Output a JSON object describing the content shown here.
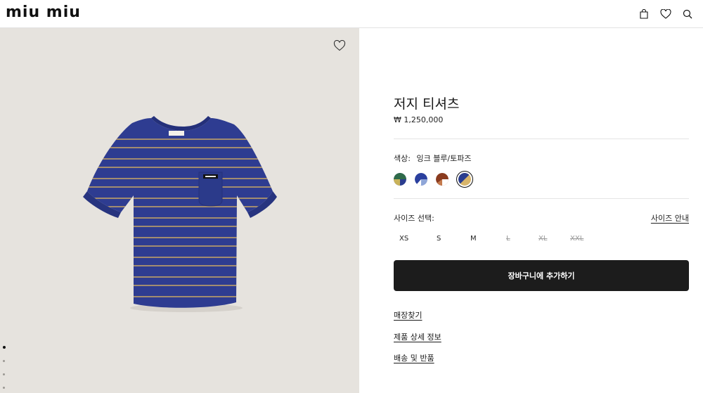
{
  "header": {
    "logo": "miu miu",
    "icons": [
      "bag-icon",
      "heart-icon",
      "search-icon"
    ]
  },
  "image": {
    "alt": "Striped jersey T-shirt",
    "pocket_label": "MIU MIU",
    "neck_label": "Miu Miu",
    "slides": 4,
    "active_slide": 1
  },
  "product": {
    "title": "저지 티셔츠",
    "price": "₩ 1,250,000",
    "color_label": "색상:",
    "color_value": "잉크 블루/토파즈",
    "swatches": [
      {
        "name": "swatch-green-blue",
        "colors": [
          "#2f6b4a",
          "#c9b35a",
          "#2a3d8f"
        ]
      },
      {
        "name": "swatch-blue-white",
        "colors": [
          "#2a3f9e",
          "#ffffff",
          "#8fa6d8"
        ]
      },
      {
        "name": "swatch-brown-white",
        "colors": [
          "#8a3b1f",
          "#ffffff",
          "#c47a4d"
        ]
      },
      {
        "name": "swatch-ink-blue-topaz",
        "colors": [
          "#2a3d8f",
          "#d8b56a"
        ],
        "selected": true
      }
    ],
    "size_label": "사이즈 선택:",
    "size_guide": "사이즈 안내",
    "sizes": [
      {
        "label": "XS",
        "available": true
      },
      {
        "label": "S",
        "available": true
      },
      {
        "label": "M",
        "available": true
      },
      {
        "label": "L",
        "available": false
      },
      {
        "label": "XL",
        "available": false
      },
      {
        "label": "XXL",
        "available": false
      }
    ],
    "add_to_cart": "장바구니에 추가하기",
    "links": [
      "매장찾기",
      "제품 상세 정보",
      "배송 및 반품"
    ]
  },
  "colors": {
    "shirt_blue": "#2e3c91",
    "stripe": "#c8a766",
    "button": "#1c1c1c",
    "image_bg": "#e6e3de"
  }
}
